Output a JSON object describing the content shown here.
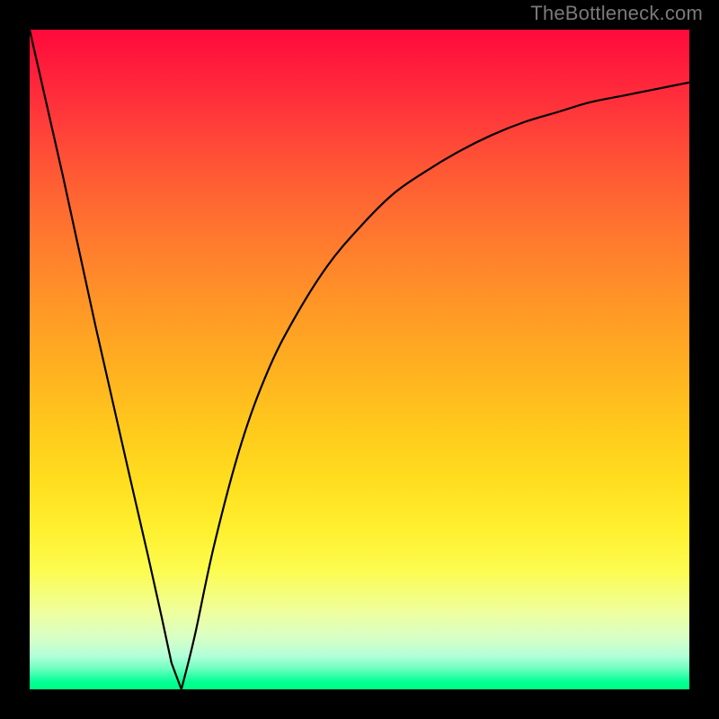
{
  "watermark": "TheBottleneck.com",
  "chart_data": {
    "type": "line",
    "title": "",
    "xlabel": "",
    "ylabel": "",
    "xlim": [
      0,
      100
    ],
    "ylim": [
      0,
      100
    ],
    "grid": false,
    "legend": false,
    "background": "vertical-rainbow-gradient (red top to green bottom)",
    "series": [
      {
        "name": "bottleneck-curve",
        "color": "#000000",
        "x": [
          0,
          5,
          10,
          15,
          18,
          20,
          21.5,
          23,
          25,
          28,
          32,
          36,
          40,
          45,
          50,
          55,
          60,
          65,
          70,
          75,
          80,
          85,
          90,
          95,
          100
        ],
        "y": [
          100,
          78,
          55,
          33,
          20,
          11,
          4,
          0,
          8,
          22,
          37,
          48,
          56,
          64,
          70,
          75,
          78.5,
          81.5,
          84,
          86,
          87.5,
          89,
          90,
          91,
          92
        ]
      }
    ],
    "marker": {
      "x": 23,
      "y": 0,
      "shape": "rounded-rect",
      "color": "#e0716e"
    },
    "annotations": []
  }
}
